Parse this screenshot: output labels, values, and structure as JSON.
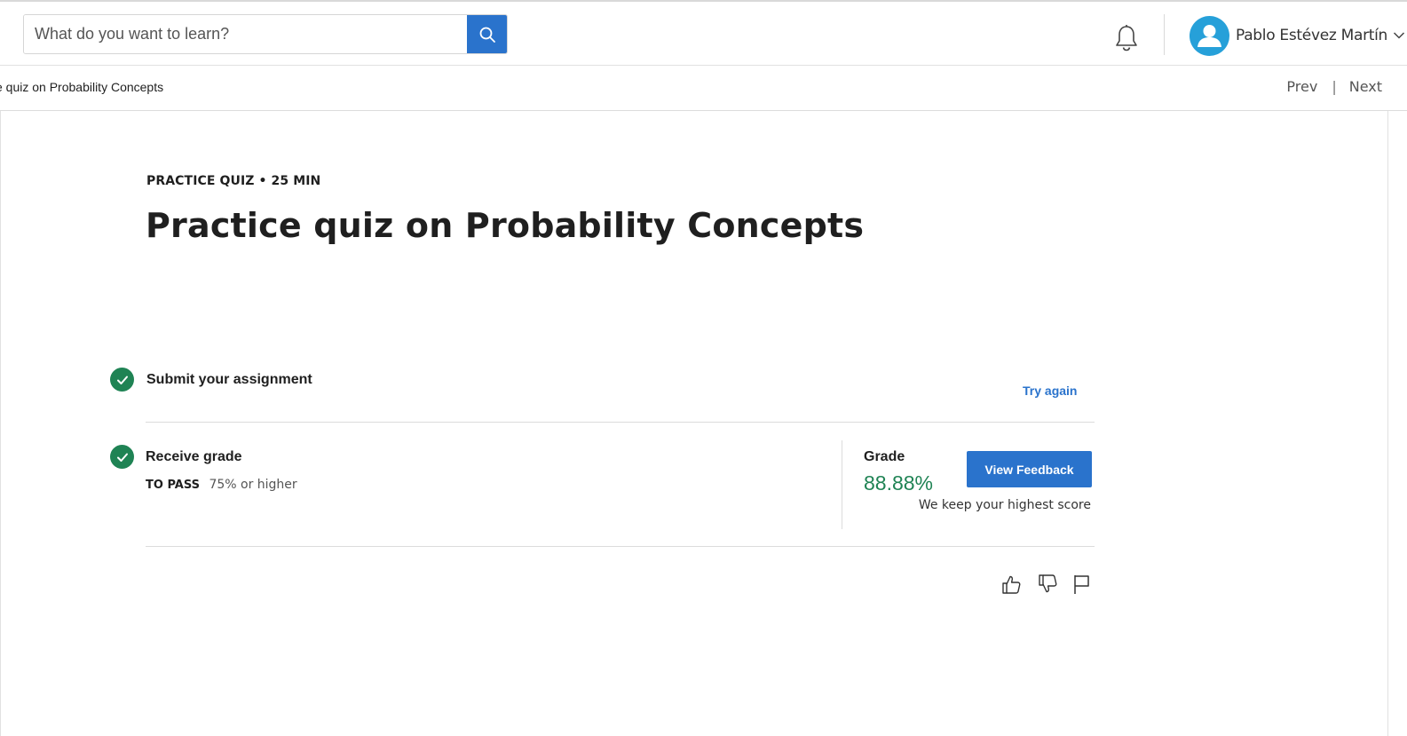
{
  "header": {
    "search": {
      "placeholder": "What do you want to learn?",
      "value": "",
      "button_icon": "search-icon"
    },
    "notifications_icon": "bell-icon",
    "user": {
      "name": "Pablo Estévez Martín",
      "avatar_icon": "user-avatar-icon",
      "menu_icon": "chevron-down-icon"
    }
  },
  "subnav": {
    "breadcrumb": "e quiz on Probability Concepts",
    "prev_label": "Prev",
    "separator": "|",
    "next_label": "Next"
  },
  "main": {
    "eyebrow": "PRACTICE QUIZ • 25 MIN",
    "title": "Practice quiz on Probability Concepts",
    "steps": {
      "submit": {
        "title": "Submit your assignment",
        "status_icon": "check-circle-icon",
        "action_label": "Try again"
      },
      "grade": {
        "title": "Receive grade",
        "status_icon": "check-circle-icon",
        "to_pass_label": "TO PASS",
        "to_pass_value": "75% or higher",
        "grade_label": "Grade",
        "grade_value": "88.88%",
        "feedback_button": "View Feedback",
        "note": "We keep your highest score"
      }
    },
    "feedback_icons": [
      "thumbs-up-icon",
      "thumbs-down-icon",
      "flag-icon"
    ]
  },
  "colors": {
    "accent_blue": "#2a73cc",
    "success_green": "#1f8354",
    "avatar_blue": "#26a0d9",
    "text_dark": "#1f1f1f",
    "divider": "#dcdcdc"
  }
}
